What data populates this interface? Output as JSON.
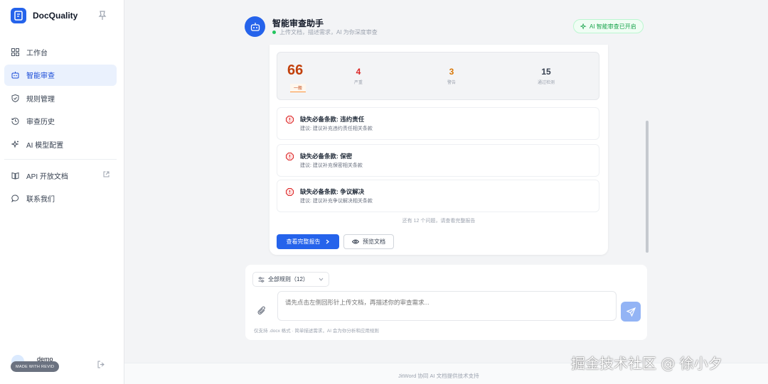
{
  "app": {
    "name": "DocQuality",
    "accent": "#2563eb"
  },
  "sidebar": {
    "items": [
      {
        "label": "工作台",
        "icon": "dashboard-icon"
      },
      {
        "label": "智能审查",
        "icon": "robot-icon",
        "active": true
      },
      {
        "label": "规则管理",
        "icon": "shield-icon"
      },
      {
        "label": "审查历史",
        "icon": "history-icon"
      },
      {
        "label": "AI 模型配置",
        "icon": "sparkle-icon"
      }
    ],
    "secondary": [
      {
        "label": "API 开放文档",
        "icon": "book-icon",
        "external": true
      },
      {
        "label": "联系我们",
        "icon": "chat-icon"
      }
    ],
    "user": {
      "name": "demo",
      "badge": "MADE WITH REVID"
    }
  },
  "header": {
    "title": "智能审查助手",
    "subtitle": "上传文档，描述需求，AI 为你深度审查",
    "status_badge": "AI 智能审查已开启"
  },
  "result": {
    "score": "66",
    "score_level": "一般",
    "stats": [
      {
        "value": "4",
        "label": "严重",
        "color": "#dc2626"
      },
      {
        "value": "3",
        "label": "警告",
        "color": "#d97706"
      },
      {
        "value": "15",
        "label": "通过检测",
        "color": "#374151"
      }
    ],
    "issues": [
      {
        "title": "缺失必备条款: 违约责任",
        "detail": "建议: 建议补充违约责任相关条款"
      },
      {
        "title": "缺失必备条款: 保密",
        "detail": "建议: 建议补充保密相关条款"
      },
      {
        "title": "缺失必备条款: 争议解决",
        "detail": "建议: 建议补充争议解决相关条款"
      }
    ],
    "more_text": "还有 12 个问题，请查看完整报告",
    "primary_button": "查看完整报告",
    "secondary_button": "预览文档"
  },
  "composer": {
    "rule_select": "全部规则（12）",
    "placeholder": "请先点击左侧回形针上传文档，再描述你的审查需求...",
    "hint": "仅支持 .docx 格式 · 简单描述需求，AI 会为你分析和应用规则"
  },
  "footer": {
    "text": "JitWord 协同 AI 文档提供技术支持"
  },
  "watermark": "掘金技术社区 @ 徐小夕"
}
